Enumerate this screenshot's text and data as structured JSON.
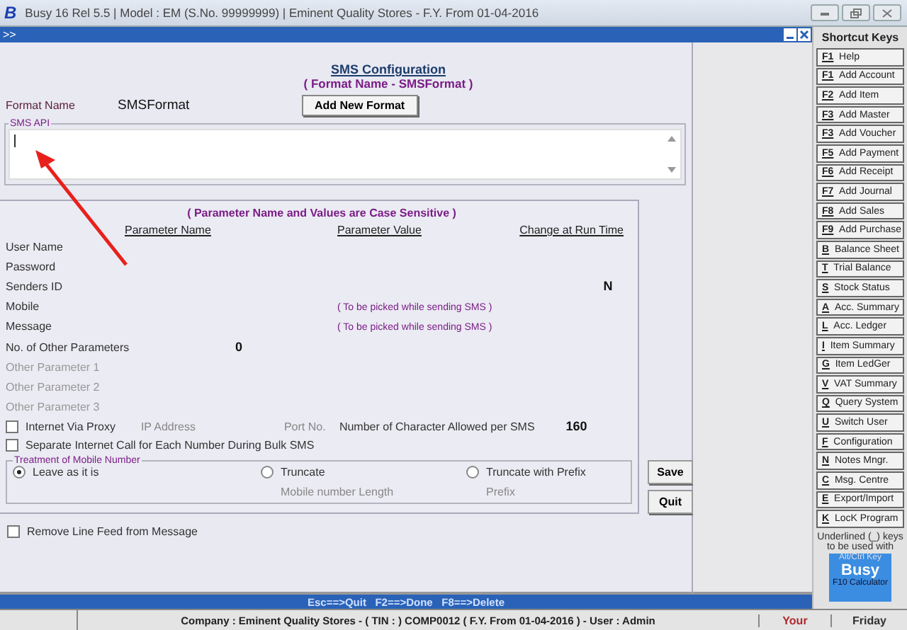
{
  "window": {
    "title": "Busy 16  Rel 5.5  |  Model : EM (S.No. 99999999)  |  Eminent Quality Stores - F.Y. From 01-04-2016",
    "logo": "B"
  },
  "toolbar": {
    "expand": ">>"
  },
  "form": {
    "title": "SMS Configuration",
    "subtitle": "( Format Name - SMSFormat )",
    "format_label": "Format Name",
    "format_value": "SMSFormat",
    "add_button": "Add New Format",
    "api_label": "SMS API",
    "note": "( Parameter Name and Values are Case Sensitive )",
    "columns": [
      "Parameter Name",
      "Parameter Value",
      "Change at Run Time"
    ],
    "rows": [
      {
        "name": "User Name",
        "disabled": false
      },
      {
        "name": "Password",
        "disabled": false
      },
      {
        "name": "Senders ID",
        "disabled": false,
        "change": "N"
      },
      {
        "name": "Mobile",
        "disabled": false,
        "value": "( To be picked while sending SMS )"
      },
      {
        "name": "Message",
        "disabled": false,
        "value": "( To be picked while sending SMS )"
      },
      {
        "name": "No. of Other Parameters",
        "disabled": false,
        "count": "0"
      },
      {
        "name": "Other Parameter 1",
        "disabled": true
      },
      {
        "name": "Other Parameter 2",
        "disabled": true
      },
      {
        "name": "Other Parameter 3",
        "disabled": true
      }
    ],
    "proxy": {
      "label": "Internet Via Proxy",
      "checked": false,
      "ip_label": "IP Address",
      "port_label": "Port No.",
      "chars_label": "Number of Character Allowed per SMS",
      "chars_value": "160"
    },
    "separate_call": {
      "label": "Separate Internet Call for Each Number During Bulk SMS",
      "checked": false
    },
    "treatment": {
      "label": "Treatment of Mobile Number",
      "options": [
        {
          "label": "Leave as it is",
          "selected": true
        },
        {
          "label": "Truncate",
          "selected": false,
          "sub": "Mobile number Length"
        },
        {
          "label": "Truncate with Prefix",
          "selected": false,
          "sub": "Prefix"
        }
      ]
    },
    "remove_linefeed": {
      "label": "Remove Line Feed from Message",
      "checked": false
    },
    "buttons": [
      "Save",
      "Quit"
    ]
  },
  "shortcuts": {
    "title": "Shortcut Keys",
    "items": [
      {
        "key": "F1",
        "label": "Help"
      },
      {
        "key": "F1",
        "label": "Add Account"
      },
      {
        "key": "F2",
        "label": "Add Item"
      },
      {
        "key": "F3",
        "label": "Add Master"
      },
      {
        "key": "F3",
        "label": "Add Voucher"
      },
      {
        "key": "F5",
        "label": "Add Payment"
      },
      {
        "key": "F6",
        "label": "Add Receipt"
      },
      {
        "key": "F7",
        "label": "Add Journal"
      },
      {
        "key": "F8",
        "label": "Add Sales"
      },
      {
        "key": "F9",
        "label": "Add Purchase"
      },
      {
        "key": "B",
        "label": "Balance Sheet"
      },
      {
        "key": "T",
        "label": "Trial Balance"
      },
      {
        "key": "S",
        "label": "Stock Status"
      },
      {
        "key": "A",
        "label": "Acc. Summary"
      },
      {
        "key": "L",
        "label": "Acc. Ledger"
      },
      {
        "key": "I",
        "label": "Item Summary"
      },
      {
        "key": "G",
        "label": "Item LedGer"
      },
      {
        "key": "V",
        "label": "VAT Summary"
      },
      {
        "key": "Q",
        "label": "Query System"
      },
      {
        "key": "U",
        "label": "Switch User"
      },
      {
        "key": "F",
        "label": "Configuration"
      },
      {
        "key": "N",
        "label": "Notes Mngr."
      },
      {
        "key": "C",
        "label": "Msg. Centre"
      },
      {
        "key": "E",
        "label": "Export/Import"
      },
      {
        "key": "K",
        "label": "LocK Program"
      }
    ],
    "note": "Underlined (_) keys to be used with",
    "note2": "Alt/Ctrl Key",
    "brand": "Busy",
    "calculator": "F10 Calculator"
  },
  "hint_bar": "Esc==>Quit   F2==>Done   F8==>Delete",
  "status_bar": {
    "company": "Company : Eminent Quality Stores - ( TIN :  ) COMP0012 ( F.Y. From 01-04-2016 ) - User : Admin",
    "message": "Your",
    "day": "Friday"
  }
}
